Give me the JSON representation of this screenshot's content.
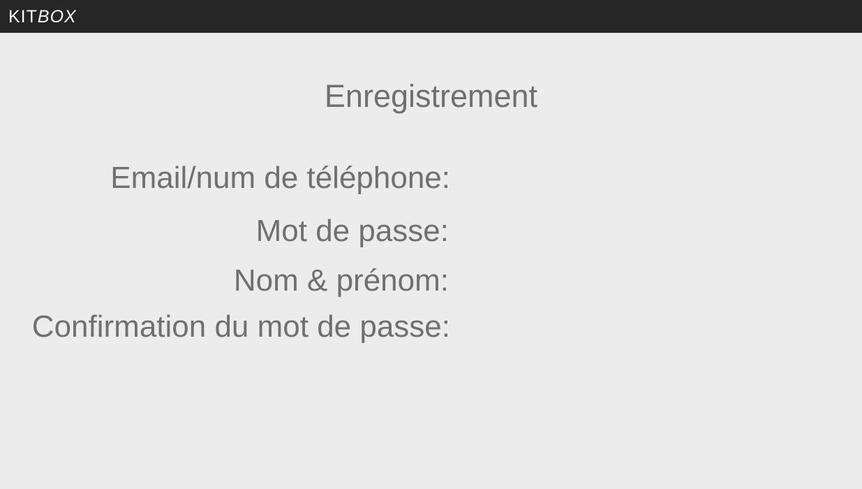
{
  "header": {
    "logo_part1": "KIT",
    "logo_part2": "BOX",
    "background_color": "#262626"
  },
  "page": {
    "title": "Enregistrement",
    "background_color": "#ececec",
    "text_color": "#707070"
  },
  "form": {
    "labels": {
      "email": "Email/num de téléphone:",
      "password": "Mot de passe:",
      "full_name": "Nom & prénom:",
      "confirm_password": "Confirmation du mot de passe:"
    }
  }
}
